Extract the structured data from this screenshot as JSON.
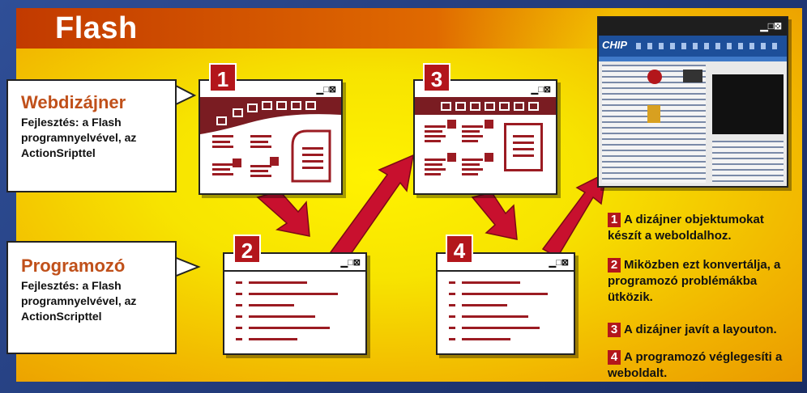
{
  "title": "Flash",
  "callouts": [
    {
      "heading": "Webdizájner",
      "text": "Fejlesztés: a Flash programnyelvével, az ActionSripttel"
    },
    {
      "heading": "Programozó",
      "text": "Fejlesztés: a Flash programnyelvével, az ActionScripttel"
    }
  ],
  "windows": [
    {
      "number": "1",
      "controls": "▁□⊠"
    },
    {
      "number": "2",
      "controls": "▁□⊠"
    },
    {
      "number": "3",
      "controls": "▁□⊠"
    },
    {
      "number": "4",
      "controls": "▁□⊠"
    }
  ],
  "screenshot": {
    "logo": "CHIP",
    "controls": "▁□⊠"
  },
  "legend": [
    {
      "number": "1",
      "text": "A dizájner objektumokat készít a weboldalhoz."
    },
    {
      "number": "2",
      "text": "Miközben ezt konvertálja, a programozó problémákba ütközik."
    },
    {
      "number": "3",
      "text": "A dizájner javít a layouton."
    },
    {
      "number": "4",
      "text": "A programozó véglegesíti a weboldalt."
    }
  ],
  "colors": {
    "accent": "#b3161b",
    "heading": "#c0501a",
    "background": "#233a73"
  }
}
